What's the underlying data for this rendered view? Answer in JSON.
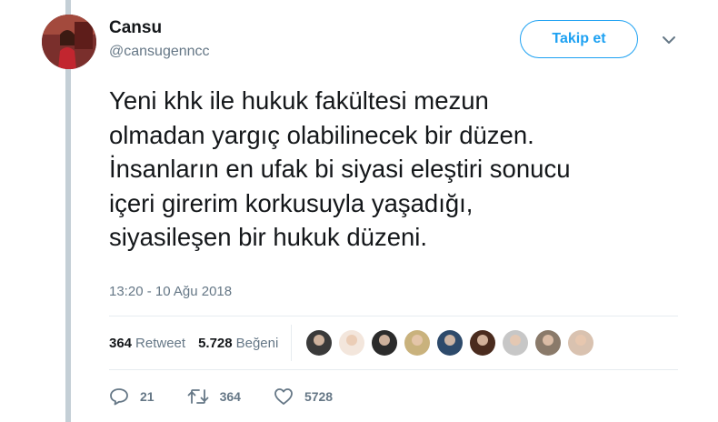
{
  "author": {
    "name": "Cansu",
    "handle": "@cansugenncc"
  },
  "follow_button_label": "Takip et",
  "tweet": {
    "text": "Yeni khk ile hukuk fakültesi mezun\nolmadan yargıç olabilinecek bir düzen.\nİnsanların en ufak bi siyasi eleştiri sonucu\niçeri girerim korkusuyla yaşadığı,\nsiyasileşen bir hukuk düzeni.",
    "timestamp": "13:20 - 10 Ağu 2018"
  },
  "stats": {
    "retweet_count": "364",
    "retweet_label": "Retweet",
    "like_count": "5.728",
    "like_label": "Beğeni"
  },
  "liker_avatars": [
    {
      "color": "#3a3a3a"
    },
    {
      "color": "#f3e6dc"
    },
    {
      "color": "#2b2b2b"
    },
    {
      "color": "#c9b27d"
    },
    {
      "color": "#2d4a6b"
    },
    {
      "color": "#4a2b1e"
    },
    {
      "color": "#c7c7c7"
    },
    {
      "color": "#8a7a6a"
    },
    {
      "color": "#d9c2b0"
    }
  ],
  "actions": {
    "reply_count": "21",
    "retweet_count": "364",
    "like_count": "5728"
  },
  "icons": {
    "reply": "reply-icon",
    "retweet": "retweet-icon",
    "like": "heart-icon",
    "menu": "chevron-down-icon"
  },
  "colors": {
    "accent": "#1da1f2",
    "secondary_text": "#657786",
    "thread_line": "#c4cfd6"
  }
}
